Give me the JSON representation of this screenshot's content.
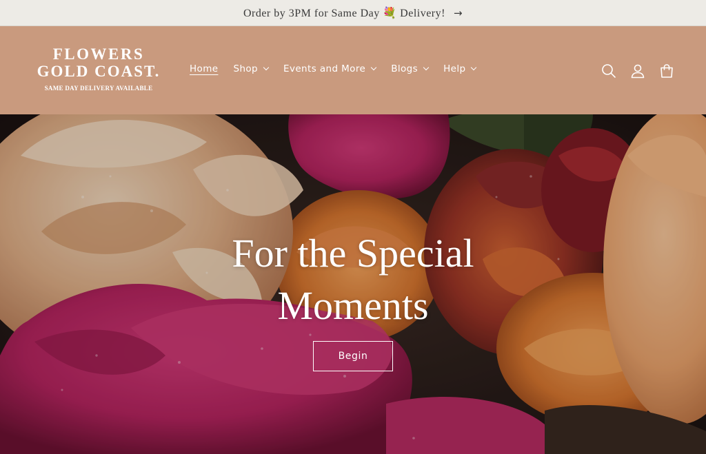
{
  "announcement": {
    "text": "Order by 3PM for Same Day 💐 Delivery!",
    "arrow": "→"
  },
  "logo": {
    "line1": "FLOWERS",
    "line2": "GOLD COAST.",
    "tagline": "SAME DAY DELIVERY AVAILABLE"
  },
  "nav": {
    "items": [
      {
        "label": "Home",
        "active": true,
        "dropdown": false
      },
      {
        "label": "Shop",
        "active": false,
        "dropdown": true
      },
      {
        "label": "Events and More",
        "active": false,
        "dropdown": true
      },
      {
        "label": "Blogs",
        "active": false,
        "dropdown": true
      },
      {
        "label": "Help",
        "active": false,
        "dropdown": true
      }
    ]
  },
  "header_icons": [
    "search-icon",
    "account-icon",
    "cart-icon"
  ],
  "hero": {
    "title_line1": "For the Special",
    "title_line2": "Moments",
    "button_label": "Begin"
  },
  "colors": {
    "announcement_bg": "#edebe6",
    "header_bg": "#c99a7e",
    "text_light": "#ffffff"
  }
}
